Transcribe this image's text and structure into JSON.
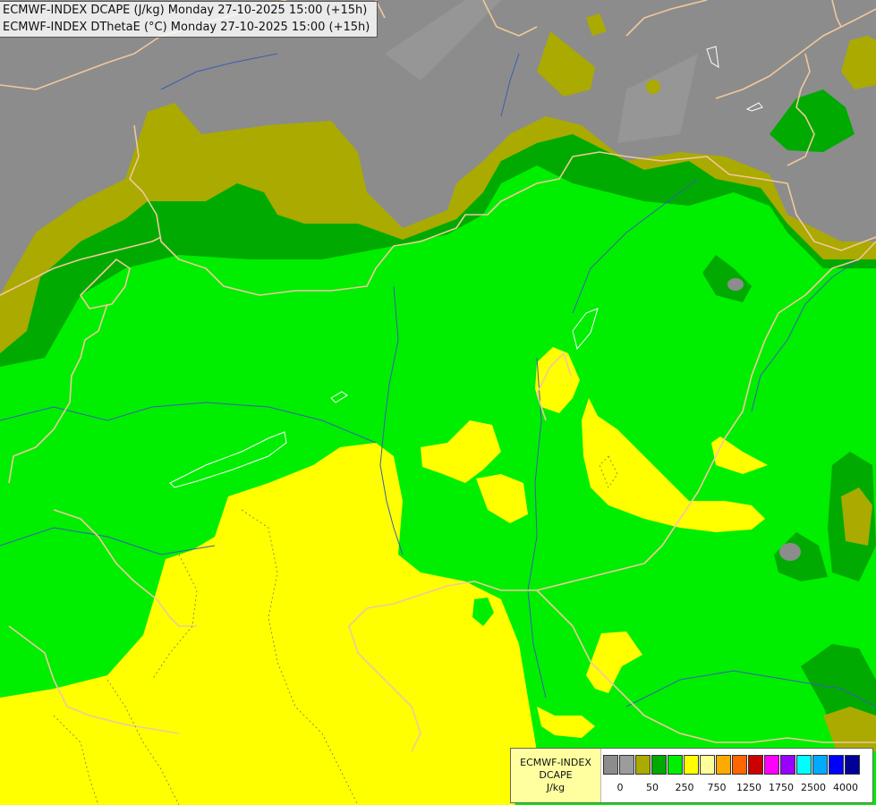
{
  "header": {
    "line1": "ECMWF-INDEX DCAPE (J/kg) Monday 27-10-2025 15:00 (+15h)",
    "line2": "ECMWF-INDEX DThetaE (°C) Monday 27-10-2025 15:00 (+15h)"
  },
  "legend": {
    "title_line1": "ECMWF-INDEX",
    "title_line2": "DCAPE",
    "unit": "J/kg",
    "colors": [
      "#8c8c8c",
      "#9c9c9c",
      "#aaaa00",
      "#00aa00",
      "#00ee00",
      "#ffff00",
      "#ffff99",
      "#ffaa00",
      "#ff6600",
      "#cc0000",
      "#ff00ff",
      "#9900ff",
      "#00ffff",
      "#00aaff",
      "#0000ff",
      "#000099"
    ],
    "tick_labels": [
      "0",
      "50",
      "250",
      "750",
      "1250",
      "1750",
      "2500",
      "4000"
    ]
  },
  "colors": {
    "gray": "#8c8c8c",
    "olive": "#aaaa00",
    "dark_green": "#00aa00",
    "green": "#00ee00",
    "yellow": "#ffff00",
    "border": "#f0c89b",
    "river": "#3a5fb0"
  }
}
